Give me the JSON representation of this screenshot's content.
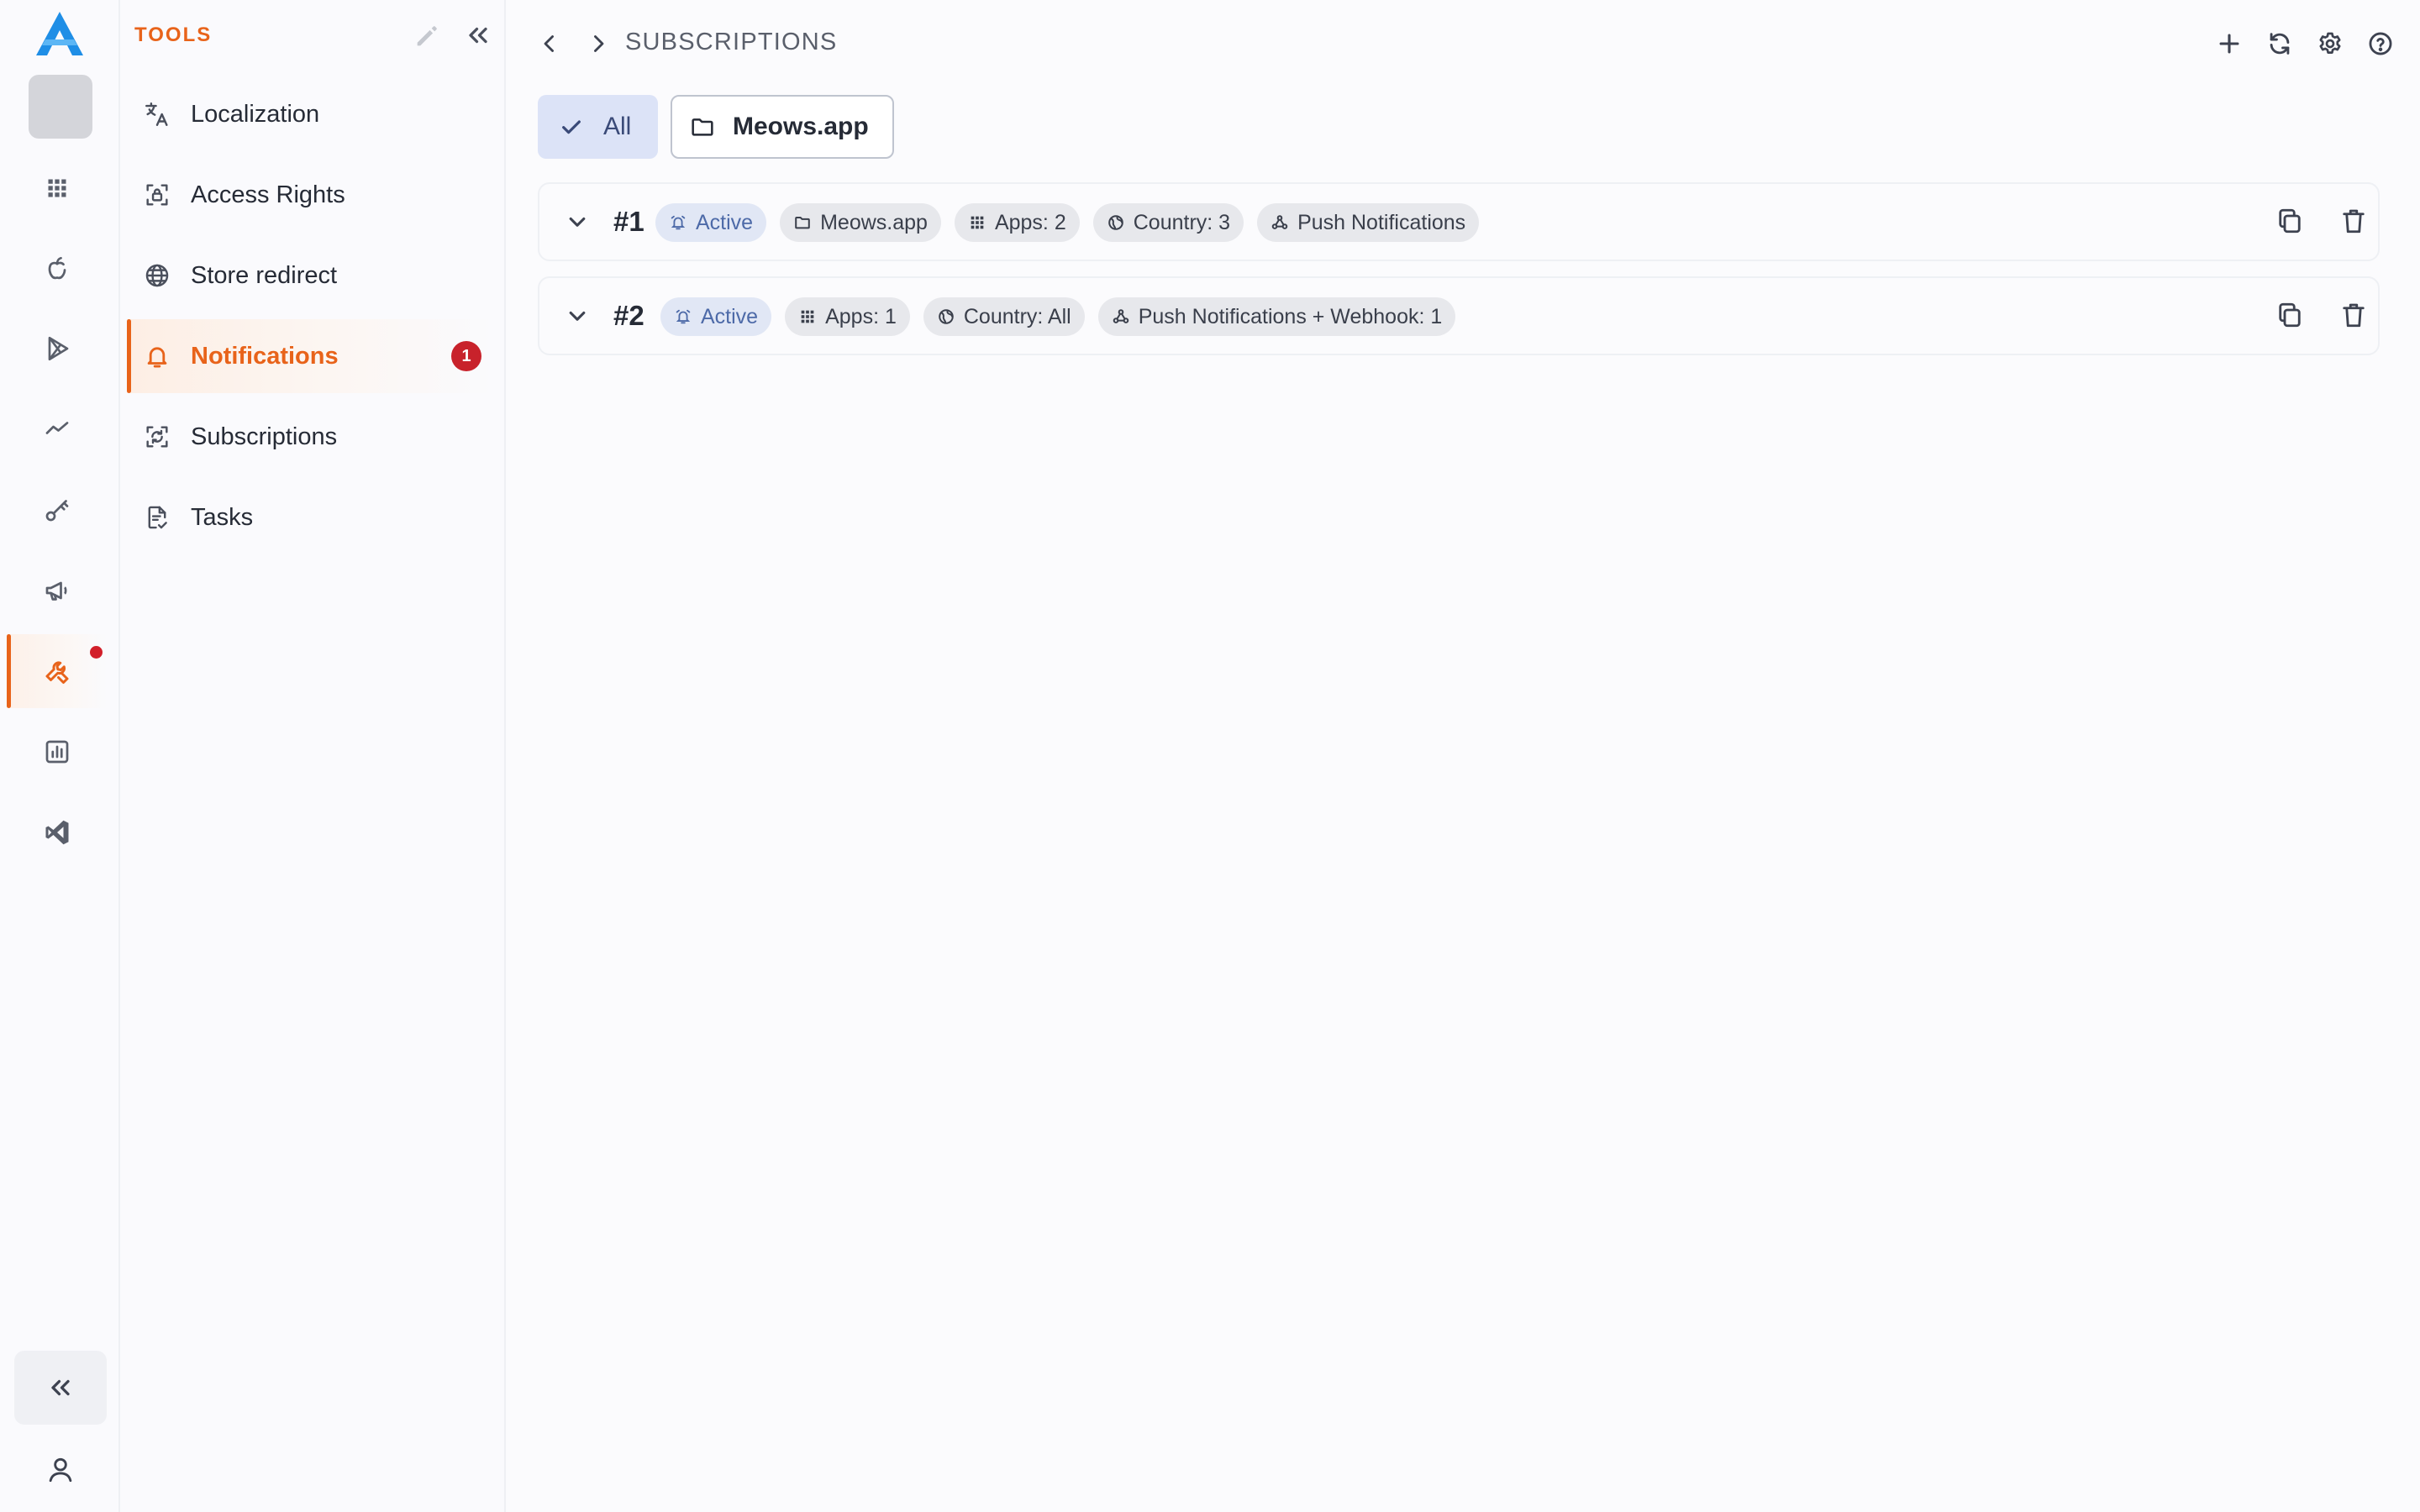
{
  "tools_panel": {
    "title": "TOOLS",
    "items": [
      {
        "label": "Localization",
        "icon": "translate-icon"
      },
      {
        "label": "Access Rights",
        "icon": "access-lock-icon"
      },
      {
        "label": "Store redirect",
        "icon": "globe-icon"
      },
      {
        "label": "Notifications",
        "icon": "bell-icon",
        "active": true,
        "badge": "1"
      },
      {
        "label": "Subscriptions",
        "icon": "subscriptions-icon"
      },
      {
        "label": "Tasks",
        "icon": "tasks-icon"
      }
    ]
  },
  "header": {
    "breadcrumb": "SUBSCRIPTIONS"
  },
  "filters": {
    "all_label": "All",
    "app_label": "Meows.app"
  },
  "subscriptions": [
    {
      "id": "#1",
      "status": "Active",
      "chips": [
        "Meows.app",
        "Apps: 2",
        "Country: 3",
        "Push Notifications"
      ]
    },
    {
      "id": "#2",
      "status": "Active",
      "chips": [
        "Apps: 1",
        "Country: All",
        "Push Notifications + Webhook: 1"
      ]
    }
  ],
  "colors": {
    "accent": "#e8631a",
    "badge": "#c8222b",
    "filter_selected": "#dce3f7",
    "status_chip": "#e1e7f5"
  }
}
